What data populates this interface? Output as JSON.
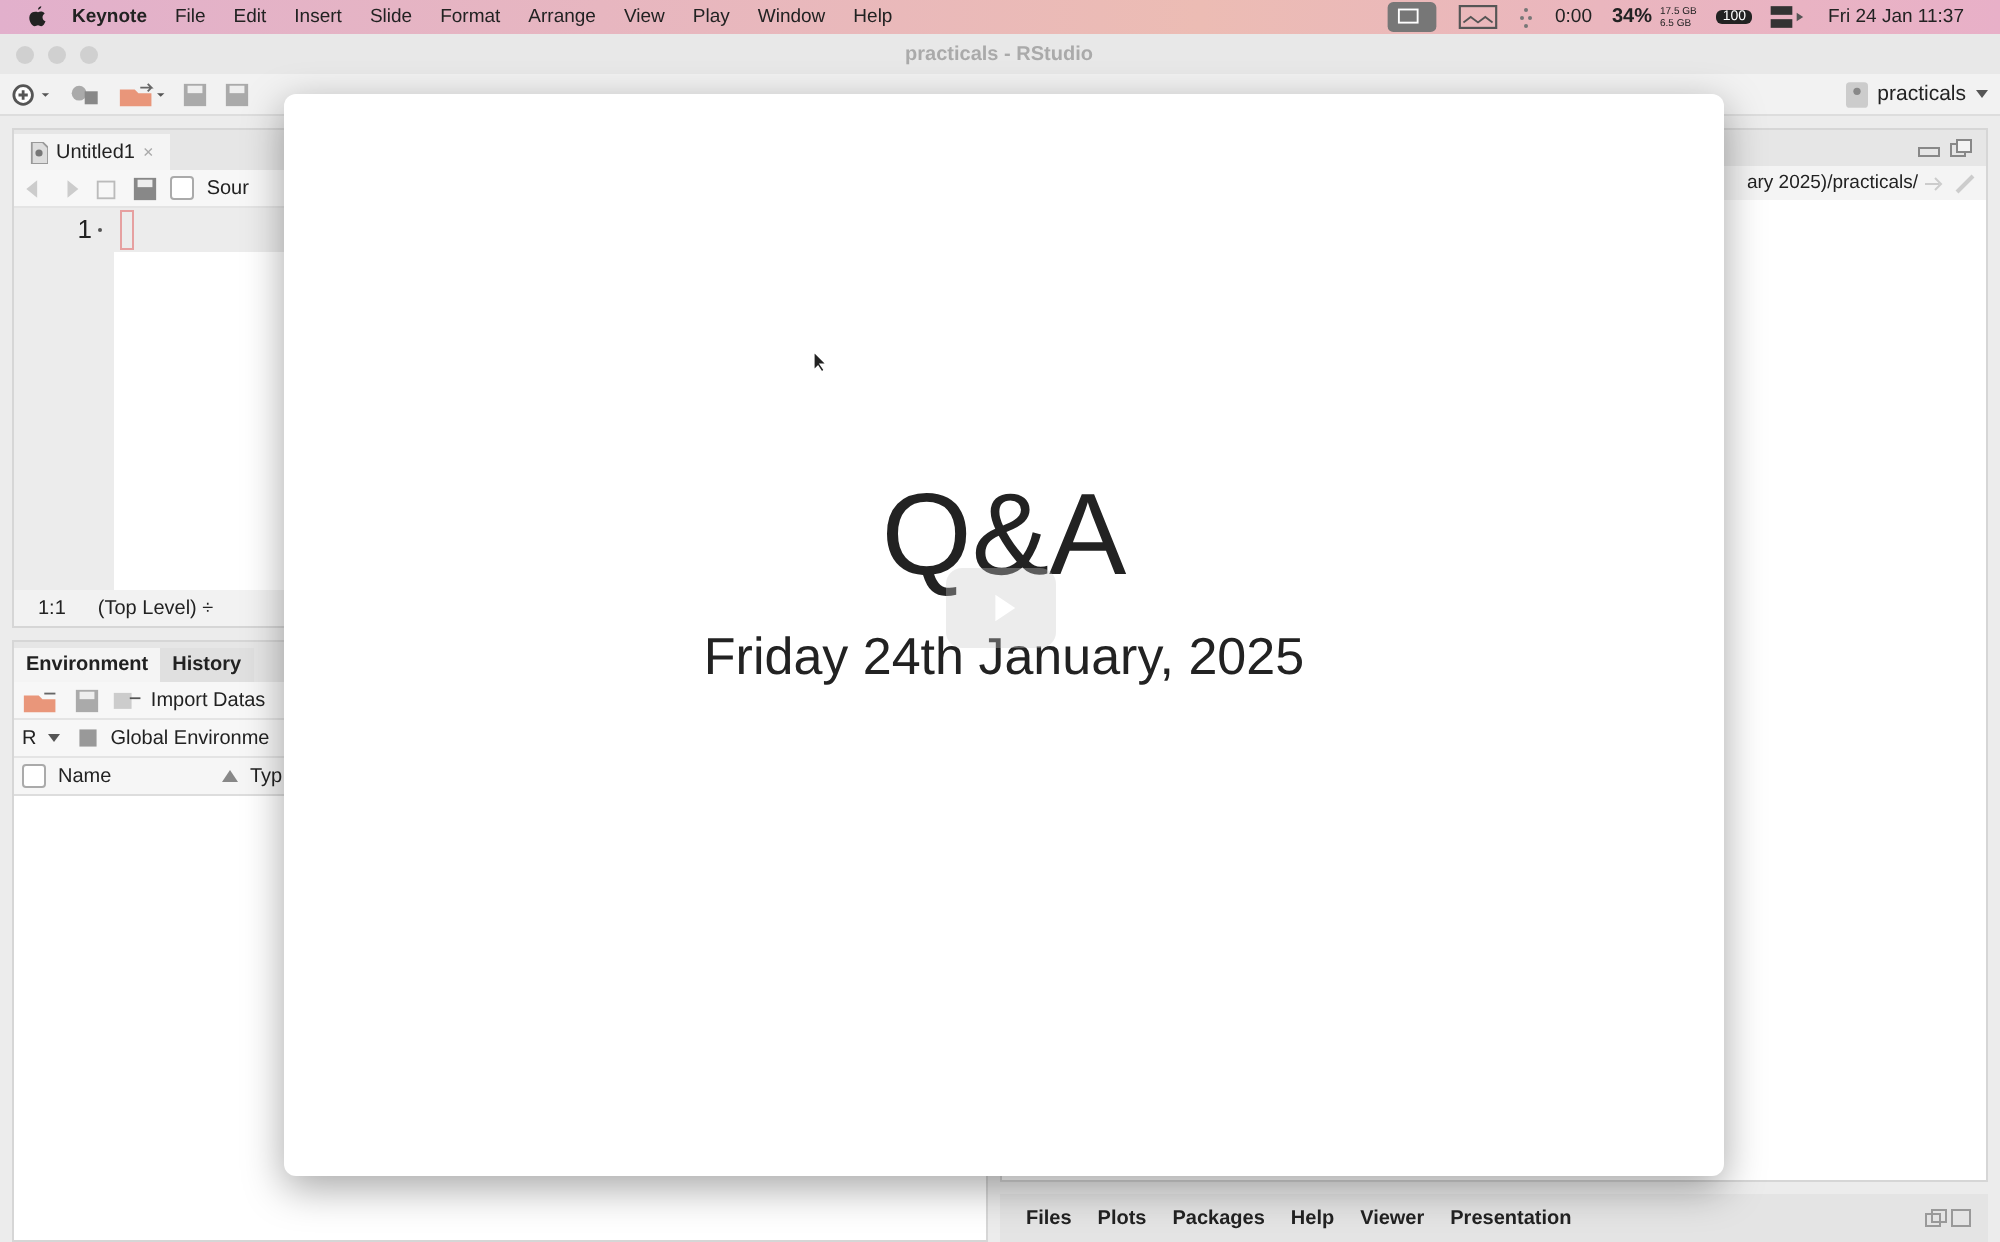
{
  "menu_bar": {
    "app": "Keynote",
    "items": [
      "File",
      "Edit",
      "Insert",
      "Slide",
      "Format",
      "Arrange",
      "View",
      "Play",
      "Window",
      "Help"
    ],
    "status": {
      "timer": "0:00",
      "cpu": "34%",
      "memory_top": "17.5 GB",
      "memory_bottom": "6.5 GB",
      "battery": "100",
      "datetime": "Fri 24 Jan 11:37"
    }
  },
  "window": {
    "title": "practicals - RStudio",
    "project": "practicals"
  },
  "editor": {
    "tab": {
      "label": "Untitled1",
      "close": "×",
      "selected": true
    },
    "source_checkbox": {
      "label": "Sour",
      "checked": false
    },
    "line_numbers": [
      "1"
    ],
    "position": "1:1",
    "scope": "(Top Level) ÷"
  },
  "environment": {
    "tabs": [
      {
        "label": "Environment",
        "selected": true
      },
      {
        "label": "History",
        "selected": false
      }
    ],
    "import_label": "Import Datas",
    "language": "R",
    "scope": "Global Environme",
    "select_all": {
      "checked": false
    },
    "columns": [
      "Name",
      "Typ"
    ]
  },
  "files_pane": {
    "path": "ary 2025)/practicals/"
  },
  "viewer_pane": {
    "tabs": [
      {
        "label": "Files",
        "selected": false
      },
      {
        "label": "Plots",
        "selected": false
      },
      {
        "label": "Packages",
        "selected": false
      },
      {
        "label": "Help",
        "selected": false
      },
      {
        "label": "Viewer",
        "selected": false
      },
      {
        "label": "Presentation",
        "selected": false
      }
    ]
  },
  "slide": {
    "title": "Q&A",
    "subtitle": "Friday 24th January, 2025"
  }
}
